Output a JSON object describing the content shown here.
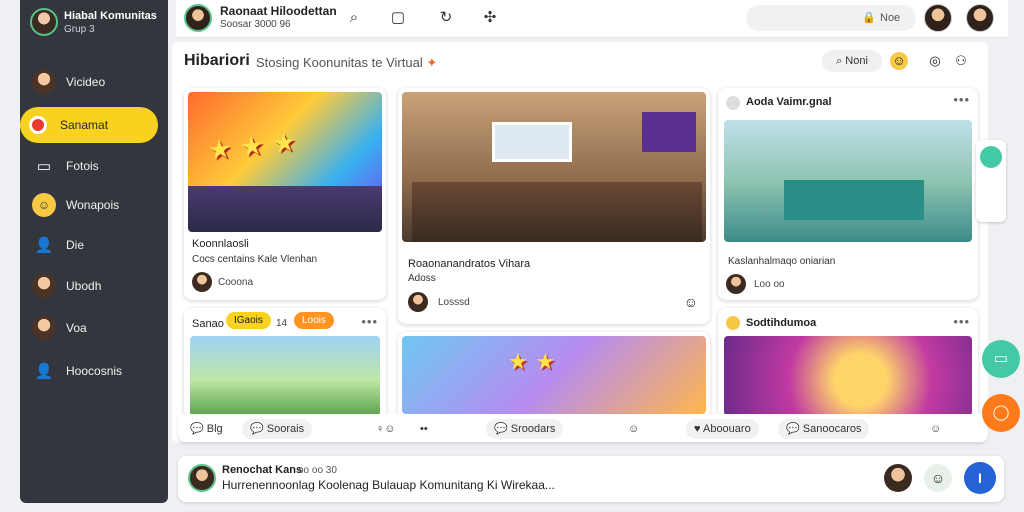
{
  "sidebar": {
    "title": "Hiabal Komunitas",
    "subtitle": "Grup 3",
    "items": [
      {
        "label": "Vicideo",
        "icon": "avatar-icon"
      },
      {
        "label": "Sanamat",
        "icon": "record-icon",
        "active": true
      },
      {
        "label": "Fotois",
        "icon": "chat-icon"
      },
      {
        "label": "Wonapois",
        "icon": "emoji-icon"
      },
      {
        "label": "Die",
        "icon": "user-icon"
      },
      {
        "label": "Ubodh",
        "icon": "avatar-icon"
      },
      {
        "label": "Voa",
        "icon": "avatar-icon"
      },
      {
        "label": "Hoocosnis",
        "icon": "user-icon"
      }
    ]
  },
  "topbar": {
    "title": "Raonaat Hiloodettan",
    "subtitle": "Soosar 3000 96",
    "search_label": "Noe"
  },
  "main": {
    "title": "Hibariori",
    "subtitle": "Stosing Koonunitas te Virtual",
    "search_btn": "Noni"
  },
  "cards": [
    {
      "title": "Koonnlaosli",
      "subtitle": "Cocs centains Kale Vlenhan",
      "meta": "Cooona"
    },
    {
      "title": "Roaonanandratos Vihara",
      "subtitle": "Adoss",
      "meta": "Losssd"
    },
    {
      "title": "Aoda Vaimr.gnal",
      "subtitle": "Kaslanhalmaqo oniarian",
      "meta": "Loo oo"
    },
    {
      "title": "Sanao",
      "tag1": "IGaois",
      "tag2": "Loois",
      "meta": "14"
    },
    {
      "title": "Sodtihdumoa"
    }
  ],
  "actions": {
    "bar1_a": "Blg",
    "bar1_b": "Soorais",
    "bar2": "Sroodars",
    "bar3_a": "Aboouaro",
    "bar3_b": "Sanoocaros"
  },
  "composer": {
    "name": "Renochat Kans",
    "meta": "oo oo 30",
    "text": "Hurrenennoonlag Koolenag Bulauap Komunitang Ki Wirekaa...",
    "send": "I"
  },
  "colors": {
    "sidebar_bg": "#33373d",
    "accent": "#f7d21e",
    "send": "#2463d6",
    "fab_green": "#43c9a6",
    "fab_orange": "#ff7a1a"
  }
}
